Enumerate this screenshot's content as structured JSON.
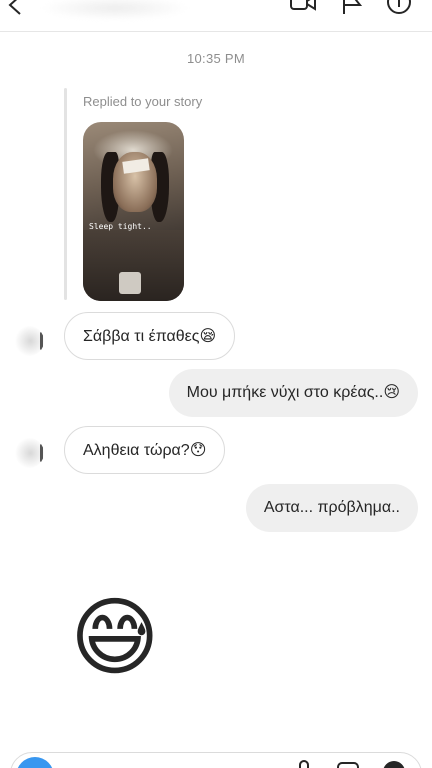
{
  "header": {
    "back_icon": "back-arrow-icon",
    "video_icon": "video-camera-icon",
    "flag_icon": "flag-icon",
    "info_icon": "info-icon"
  },
  "timestamp": "10:35 PM",
  "story_reply": {
    "label": "Replied to your story",
    "story_text": "Sleep tight.."
  },
  "messages": [
    {
      "text": "Σάββα τι έπαθες😪",
      "direction": "incoming"
    },
    {
      "text": "Μου μπήκε νύχι στο κρέας..😢",
      "direction": "outgoing"
    },
    {
      "text": "Αληθεια τώρα?😯",
      "direction": "incoming"
    },
    {
      "text": "Αστα... πρόβλημα..",
      "direction": "outgoing"
    }
  ],
  "big_emoji": "😅",
  "composer": {
    "camera_icon": "camera-icon",
    "mic_icon": "microphone-icon",
    "gallery_icon": "gallery-icon",
    "sticker_icon": "sticker-icon"
  },
  "colors": {
    "incoming_border": "#dbdbdb",
    "outgoing_bg": "#efefef",
    "meta_text": "#8e8e8e",
    "accent": "#3897f0"
  }
}
